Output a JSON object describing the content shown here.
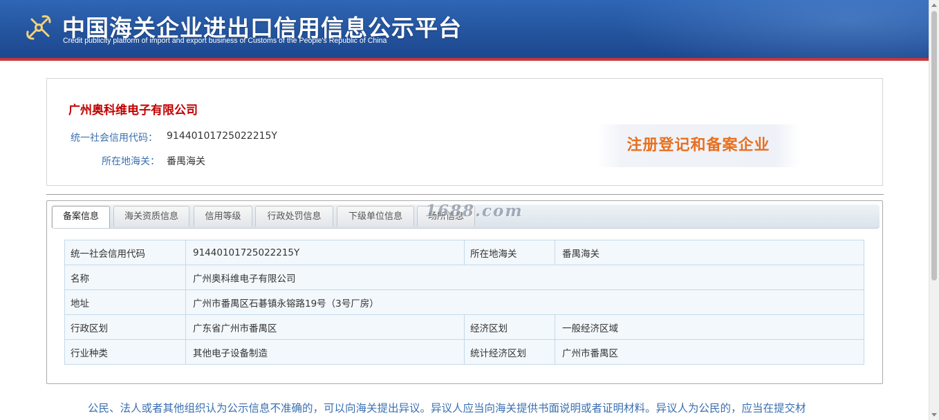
{
  "header": {
    "title_cn": "中国海关企业进出口信用信息公示平台",
    "title_en": "Credit publicity platform of import and export business of Customs of the People's Republic of China",
    "colors": {
      "header_blue": "#24549e",
      "header_strip": "#c9373a"
    }
  },
  "company": {
    "name": "广州奥科维电子有限公司",
    "credit_code_label": "统一社会信用代码：",
    "credit_code": "91440101725022215Y",
    "customs_label": "所在地海关：",
    "customs": "番禺海关",
    "badge": "注册登记和备案企业"
  },
  "tabs": [
    {
      "label": "备案信息",
      "active": true
    },
    {
      "label": "海关资质信息",
      "active": false
    },
    {
      "label": "信用等级",
      "active": false
    },
    {
      "label": "行政处罚信息",
      "active": false
    },
    {
      "label": "下级单位信息",
      "active": false
    },
    {
      "label": "场所信息",
      "active": false
    }
  ],
  "watermark": "1688.com",
  "record_table": {
    "rows": [
      {
        "label1": "统一社会信用代码",
        "value1": "91440101725022215Y",
        "label2": "所在地海关",
        "value2": "番禺海关"
      },
      {
        "label1": "名称",
        "value1": "广州奥科维电子有限公司"
      },
      {
        "label1": "地址",
        "value1": "广州市番禺区石碁镇永镕路19号（3号厂房）"
      },
      {
        "label1": "行政区划",
        "value1": "广东省广州市番禺区",
        "label2": "经济区划",
        "value2": "一般经济区域"
      },
      {
        "label1": "行业种类",
        "value1": "其他电子设备制造",
        "label2": "统计经济区划",
        "value2": "广州市番禺区"
      }
    ]
  },
  "notice": "公民、法人或者其他组织认为公示信息不准确的，可以向海关提出异议。异议人应当向海关提供书面说明或者证明材料。异议人为公民的，应当在提交材",
  "icons": {
    "logo": "customs-emblem-icon"
  }
}
